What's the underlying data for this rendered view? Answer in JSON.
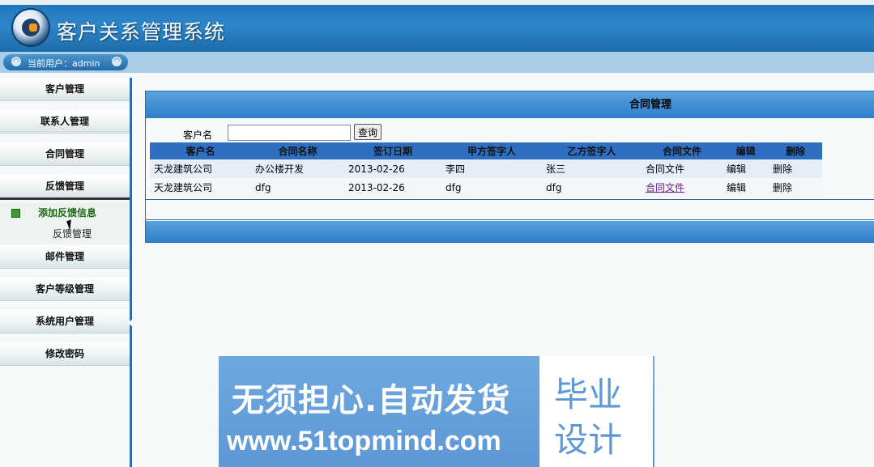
{
  "app": {
    "title": "客户关系管理系统"
  },
  "userbar": {
    "label": "当前用户：admin"
  },
  "sidebar": {
    "items": [
      {
        "label": "客户管理"
      },
      {
        "label": "联系人管理"
      },
      {
        "label": "合同管理"
      },
      {
        "label": "反馈管理"
      },
      {
        "label": "邮件管理"
      },
      {
        "label": "客户等级管理"
      },
      {
        "label": "系统用户管理"
      },
      {
        "label": "修改密码"
      }
    ],
    "submenu": [
      {
        "label": "添加反馈信息"
      },
      {
        "label": "反馈管理"
      }
    ]
  },
  "panel": {
    "title": "合同管理",
    "search": {
      "label": "客户名",
      "value": "",
      "button": "查询"
    },
    "columns": [
      "客户名",
      "合同名称",
      "签订日期",
      "甲方签字人",
      "乙方签字人",
      "合同文件",
      "编辑",
      "删除"
    ],
    "rows": [
      {
        "customer": "天龙建筑公司",
        "contract": "办公楼开发",
        "date": "2013-02-26",
        "signer_a": "李四",
        "signer_b": "张三",
        "file": "合同文件",
        "edit": "编辑",
        "delete": "删除"
      },
      {
        "customer": "天龙建筑公司",
        "contract": "dfg",
        "date": "2013-02-26",
        "signer_a": "dfg",
        "signer_b": "dfg",
        "file": "合同文件",
        "edit": "编辑",
        "delete": "删除"
      }
    ]
  },
  "watermark": {
    "line1": "无须担心.自动发货",
    "line2": "www.51topmind.com",
    "box_line1": "毕业",
    "box_line2": "设计"
  }
}
